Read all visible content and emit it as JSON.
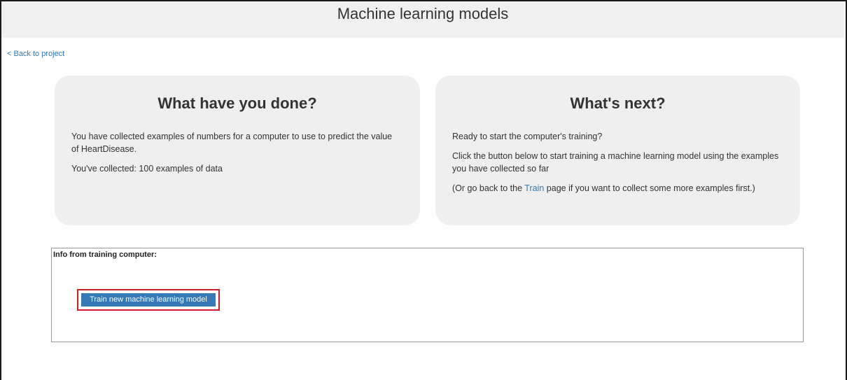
{
  "header": {
    "title": "Machine learning models"
  },
  "nav": {
    "back_link": "< Back to project"
  },
  "panels": {
    "done": {
      "heading": "What have you done?",
      "paragraph1": "You have collected examples of numbers for a computer to use to predict the value of HeartDisease.",
      "paragraph2": "You've collected: 100 examples of data"
    },
    "next": {
      "heading": "What's next?",
      "paragraph1": "Ready to start the computer's training?",
      "paragraph2": "Click the button below to start training a machine learning model using the examples you have collected so far",
      "paragraph3_before": "(Or go back to the ",
      "paragraph3_link": "Train",
      "paragraph3_after": " page if you want to collect some more examples first.)"
    }
  },
  "training_info": {
    "label": "Info from training computer:",
    "button_label": "Train new machine learning model"
  },
  "colors": {
    "accent": "#337ab7",
    "highlight": "#d11a2a",
    "panel_bg": "#efefef",
    "header_bg": "#f0f0f0"
  }
}
